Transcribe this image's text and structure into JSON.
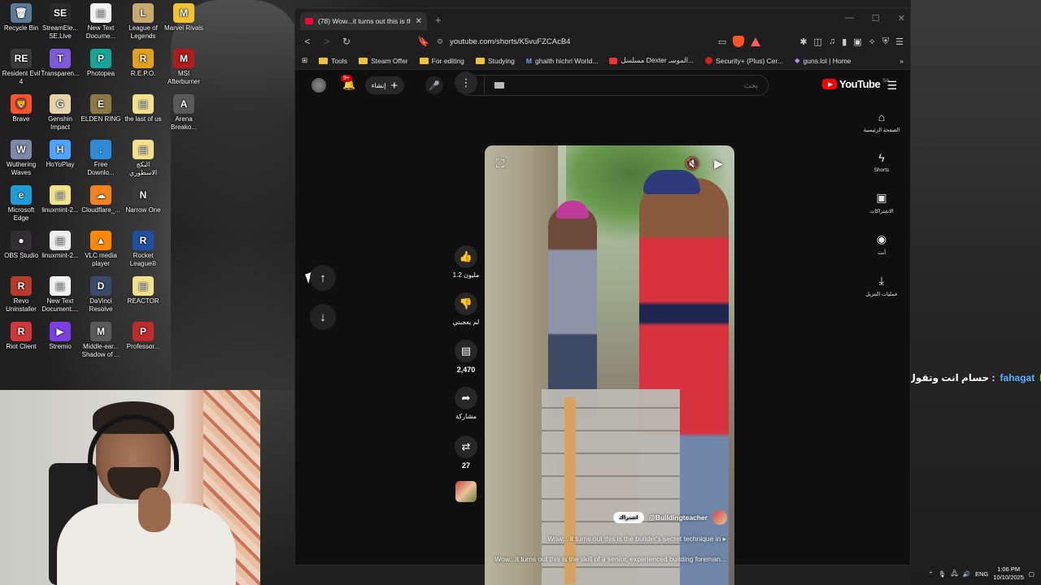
{
  "desktop": {
    "icons": [
      {
        "label": "Recycle Bin",
        "glyph": "🗑",
        "bg": "#5a7a9a"
      },
      {
        "label": "Resident Evil 4",
        "glyph": "RE",
        "bg": "#3a3a3a"
      },
      {
        "label": "Brave",
        "glyph": "🦁",
        "bg": "#fb542b"
      },
      {
        "label": "Wuthering Waves",
        "glyph": "W",
        "bg": "#7a8aa8"
      },
      {
        "label": "Microsoft Edge",
        "glyph": "e",
        "bg": "#1f9bd6"
      },
      {
        "label": "OBS Studio",
        "glyph": "●",
        "bg": "#302e31"
      },
      {
        "label": "Revo Uninstaller",
        "glyph": "R",
        "bg": "#b83a2a"
      },
      {
        "label": "Riot Client",
        "glyph": "R",
        "bg": "#d13639"
      },
      {
        "label": "StreamEle... SE.Live",
        "glyph": "SE",
        "bg": "#2a2a2a"
      },
      {
        "label": "Transparen...",
        "glyph": "T",
        "bg": "#7b5bd6"
      },
      {
        "label": "Genshin Impact",
        "glyph": "G",
        "bg": "#e6d3a8"
      },
      {
        "label": "HoYoPlay",
        "glyph": "H",
        "bg": "#4da3ff"
      },
      {
        "label": "linuxmint-2...",
        "glyph": "▤",
        "bg": "#f0e28a"
      },
      {
        "label": "linuxmint-2...",
        "glyph": "▤",
        "bg": "#eeeeee"
      },
      {
        "label": "New Text Document....",
        "glyph": "▤",
        "bg": "#f2f2f2"
      },
      {
        "label": "Stremio",
        "glyph": "▶",
        "bg": "#7b3fe4"
      },
      {
        "label": "New Text Docume...",
        "glyph": "▤",
        "bg": "#f2f2f2"
      },
      {
        "label": "Photopea",
        "glyph": "P",
        "bg": "#18a497"
      },
      {
        "label": "ELDEN RING",
        "glyph": "E",
        "bg": "#8b7a44"
      },
      {
        "label": "Free Downlo...",
        "glyph": "↓",
        "bg": "#2e8bd8"
      },
      {
        "label": "Cloudflare_...",
        "glyph": "☁",
        "bg": "#f48120"
      },
      {
        "label": "VLC media player",
        "glyph": "▲",
        "bg": "#ff8800"
      },
      {
        "label": "DaVinci Resolve",
        "glyph": "D",
        "bg": "#3a4a6a"
      },
      {
        "label": "Middle-ear... Shadow of ...",
        "glyph": "M",
        "bg": "#5a5a5a"
      },
      {
        "label": "League of Legends",
        "glyph": "L",
        "bg": "#c8aa6e"
      },
      {
        "label": "R.E.P.O.",
        "glyph": "R",
        "bg": "#e0a020"
      },
      {
        "label": "the last of us",
        "glyph": "▤",
        "bg": "#f2e08a"
      },
      {
        "label": "البكج الاسطوري",
        "glyph": "▤",
        "bg": "#f2e08a"
      },
      {
        "label": "Narrow One",
        "glyph": "N",
        "bg": "#3a3a3a"
      },
      {
        "label": "Rocket League®",
        "glyph": "R",
        "bg": "#1f4fa0"
      },
      {
        "label": "REACTOR",
        "glyph": "▤",
        "bg": "#f2e08a"
      },
      {
        "label": "Professor...",
        "glyph": "P",
        "bg": "#c02a2a"
      },
      {
        "label": "Marvel Rivals",
        "glyph": "M",
        "bg": "#f2c232"
      },
      {
        "label": "MSI Afterburner",
        "glyph": "M",
        "bg": "#b01c1c"
      },
      {
        "label": "Arena Breako...",
        "glyph": "A",
        "bg": "#5a5a5a"
      }
    ],
    "chat_username": "fahagat",
    "chat_message": "حسام انت وتقول أنا حلفت إني تيك وكذا :",
    "chat_icon": "K"
  },
  "browser": {
    "tab_title": "(78) Wow...it turns out this is the",
    "url": "youtube.com/shorts/K5vuFZCAcB4",
    "bookmarks": [
      "Tools",
      "Steam Offer",
      "For editing",
      "Studying",
      "ghaith hichri World...",
      "مسلسل Dexter الموسـ...",
      "Security+ (Plus) Cer...",
      "guns.lol | Home"
    ]
  },
  "youtube": {
    "notification_count": "9+",
    "create_label": "إنشاء",
    "search_placeholder": "بحث",
    "logo_text": "YouTube",
    "logo_region": "SA",
    "rnav": [
      "الصفحة الرئيسية",
      "Shorts",
      "الاشتراكات",
      "أنت",
      "عمليات التنزيل"
    ],
    "actions": {
      "likes": "1.2 مليون",
      "dislike_label": "لم يعجبني",
      "comments": "2,470",
      "share_label": "مشاركة",
      "remixes": "27"
    },
    "video": {
      "channel": "@Buildingteacher",
      "subscribe_label": "اشتراك",
      "title": "Wow... it turns out this is the builder's secret technique in",
      "description": "Wow...it turns out this is the skill of a senior, experienced building foreman...",
      "progress": 0.95
    }
  },
  "taskbar": {
    "language": "ENG",
    "time": "1:06 PM",
    "date": "10/10/2025"
  },
  "colors": {
    "yt_red": "#ff0000",
    "bg_dark": "#0f0f0f"
  }
}
